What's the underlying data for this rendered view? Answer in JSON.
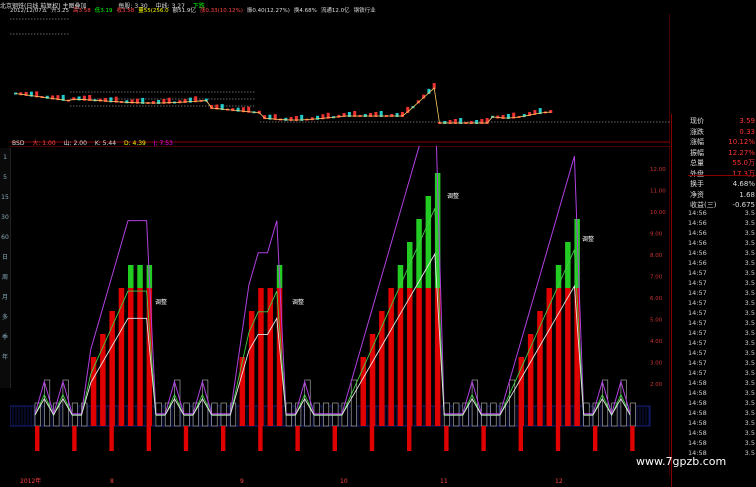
{
  "topbar": {
    "title": "北京钢铁(日线 前复权) 主图叠加",
    "price": "每股: 3.30",
    "mid": "中线: 3.27",
    "status": "下跌"
  },
  "infobar": {
    "items": [
      "2012/12/07五",
      "开3.25",
      "高3.58",
      "低3.19",
      "收3.58",
      "量55(256.0",
      "额51.9亿",
      "涨0.33(10.12%)",
      "振0.40(12.27%)",
      "换4.68%",
      "流通12.0亿",
      "钢铁行业"
    ]
  },
  "indicator_header": {
    "name": "BSD",
    "items": [
      "大: 1.00",
      "山: 2.00",
      "K: 5.44",
      "D: 4.39",
      "J: 7.53"
    ]
  },
  "left_toolbar": {
    "items": [
      "1",
      "5",
      "15",
      "30",
      "60",
      "日",
      "周",
      "月",
      "多",
      "季",
      "年"
    ]
  },
  "right_panel": {
    "rows": [
      {
        "label": "现价",
        "value": "3.59"
      },
      {
        "label": "涨跌",
        "value": "0.33"
      },
      {
        "label": "涨幅",
        "value": "10.12%"
      },
      {
        "label": "振幅",
        "value": "12.27%"
      },
      {
        "label": "总量",
        "value": "55.0万"
      },
      {
        "label": "外盘",
        "value": "17.3万"
      },
      {
        "label": "换手",
        "value": "4.68%"
      },
      {
        "label": "净资",
        "value": "1.68"
      },
      {
        "label": "收益(三)",
        "value": "-0.675"
      }
    ],
    "ticks": [
      {
        "time": "14:56",
        "v": "3.5"
      },
      {
        "time": "14:56",
        "v": "3.5"
      },
      {
        "time": "14:56",
        "v": "3.5"
      },
      {
        "time": "14:56",
        "v": "3.5"
      },
      {
        "time": "14:56",
        "v": "3.5"
      },
      {
        "time": "14:56",
        "v": "3.5"
      },
      {
        "time": "14:57",
        "v": "3.5"
      },
      {
        "time": "14:57",
        "v": "3.5"
      },
      {
        "time": "14:57",
        "v": "3.5"
      },
      {
        "time": "14:57",
        "v": "3.5"
      },
      {
        "time": "14:57",
        "v": "3.5"
      },
      {
        "time": "14:57",
        "v": "3.5"
      },
      {
        "time": "14:57",
        "v": "3.5"
      },
      {
        "time": "14:57",
        "v": "3.5"
      },
      {
        "time": "14:57",
        "v": "3.5"
      },
      {
        "time": "14:57",
        "v": "3.5"
      },
      {
        "time": "14:57",
        "v": "3.5"
      },
      {
        "time": "14:58",
        "v": "3.5"
      },
      {
        "time": "14:58",
        "v": "3.5"
      },
      {
        "time": "14:58",
        "v": "3.5"
      },
      {
        "time": "14:58",
        "v": "3.5"
      },
      {
        "time": "14:58",
        "v": "3.5"
      },
      {
        "time": "14:58",
        "v": "3.5"
      },
      {
        "time": "14:58",
        "v": "3.5"
      },
      {
        "time": "14:58",
        "v": "3.5"
      }
    ]
  },
  "indicator_axis": [
    "12.00",
    "11.00",
    "10.00",
    "9.00",
    "8.00",
    "7.00",
    "6.00",
    "5.00",
    "4.00",
    "3.00",
    "2.00"
  ],
  "annotations": [
    "调整",
    "调整",
    "调整",
    "调整"
  ],
  "date_axis": [
    "2012年",
    "8",
    "9",
    "10",
    "11",
    "12"
  ],
  "watermark": "www.7gpzb.com",
  "colors": {
    "up": "#e00000",
    "top": "#22cc22",
    "blue": "#2233cc",
    "purple": "#b040e0",
    "green_line": "#44cc44",
    "white_line": "#e8e8e8"
  },
  "chart_data": {
    "type": "bar",
    "ylim": [
      0,
      12
    ],
    "series": [
      {
        "name": "BSD",
        "values": [
          1,
          2,
          1,
          2,
          1,
          1,
          3,
          4,
          5,
          6,
          7,
          7,
          7,
          1,
          1,
          2,
          1,
          1,
          2,
          1,
          1,
          1,
          3,
          5,
          6,
          6,
          7,
          1,
          1,
          2,
          1,
          1,
          1,
          1,
          2,
          3,
          4,
          5,
          6,
          7,
          8,
          9,
          10,
          11,
          1,
          1,
          1,
          2,
          1,
          1,
          1,
          2,
          3,
          4,
          5,
          6,
          7,
          8,
          9,
          1,
          1,
          2,
          1,
          2,
          1
        ]
      }
    ]
  }
}
